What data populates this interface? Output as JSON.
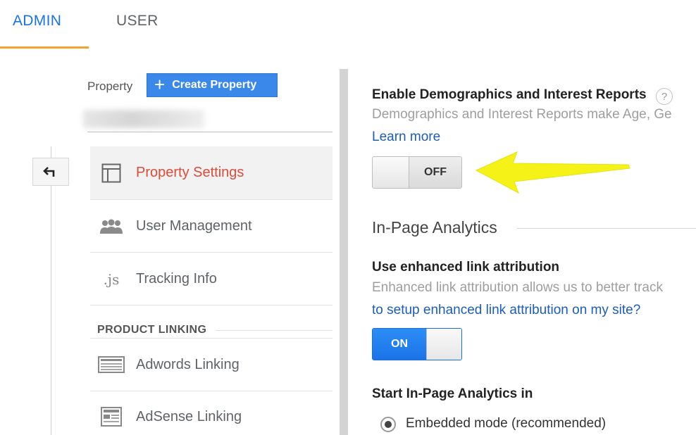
{
  "tabs": {
    "admin": "ADMIN",
    "user": "USER"
  },
  "property": {
    "label": "Property",
    "create_button": "Create Property"
  },
  "nav": {
    "items": [
      {
        "label": "Property Settings",
        "icon": "layout-icon"
      },
      {
        "label": "User Management",
        "icon": "users-icon"
      },
      {
        "label": "Tracking Info",
        "icon": "js-icon",
        "icon_text": ".js"
      },
      {
        "label": "Adwords Linking",
        "icon": "adwords-icon"
      },
      {
        "label": "AdSense Linking",
        "icon": "adsense-icon"
      }
    ],
    "section_header": "PRODUCT LINKING"
  },
  "demographics": {
    "title": "Enable Demographics and Interest Reports",
    "help": "?",
    "description": "Demographics and Interest Reports make Age, Ge",
    "learn_more": "Learn more",
    "toggle_state": "OFF"
  },
  "in_page": {
    "section_title": "In-Page Analytics",
    "link_attr_title": "Use enhanced link attribution",
    "link_attr_desc": "Enhanced link attribution allows us to better track",
    "link_attr_link": "to setup enhanced link attribution on my site?",
    "toggle_state": "ON",
    "start_title": "Start In-Page Analytics in",
    "radio_label": "Embedded mode (recommended)"
  },
  "colors": {
    "accent_blue": "#1a73e8",
    "active_red": "#dd4b39",
    "tab_underline": "#f4a430",
    "annotation_arrow": "#f5f218"
  }
}
